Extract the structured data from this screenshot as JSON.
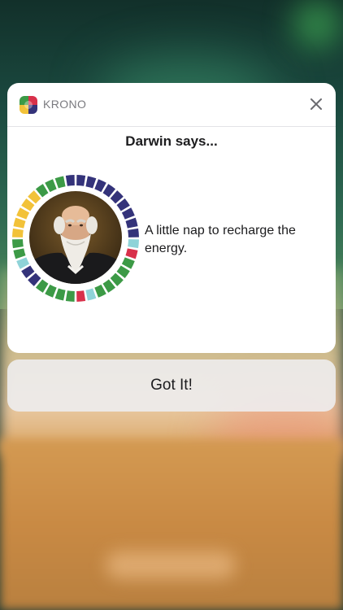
{
  "notification": {
    "app_name": "KRONO",
    "app_icon": "krono-app-icon",
    "close_icon": "close-icon",
    "title": "Darwin says...",
    "message": "A little nap to recharge the energy.",
    "avatar": "darwin-portrait",
    "ring_colors": {
      "navy": "#34337a",
      "green": "#3c9a46",
      "yellow": "#f2c239",
      "light_blue": "#8fd3d8",
      "red": "#d8304a"
    }
  },
  "action": {
    "label": "Got It!"
  }
}
